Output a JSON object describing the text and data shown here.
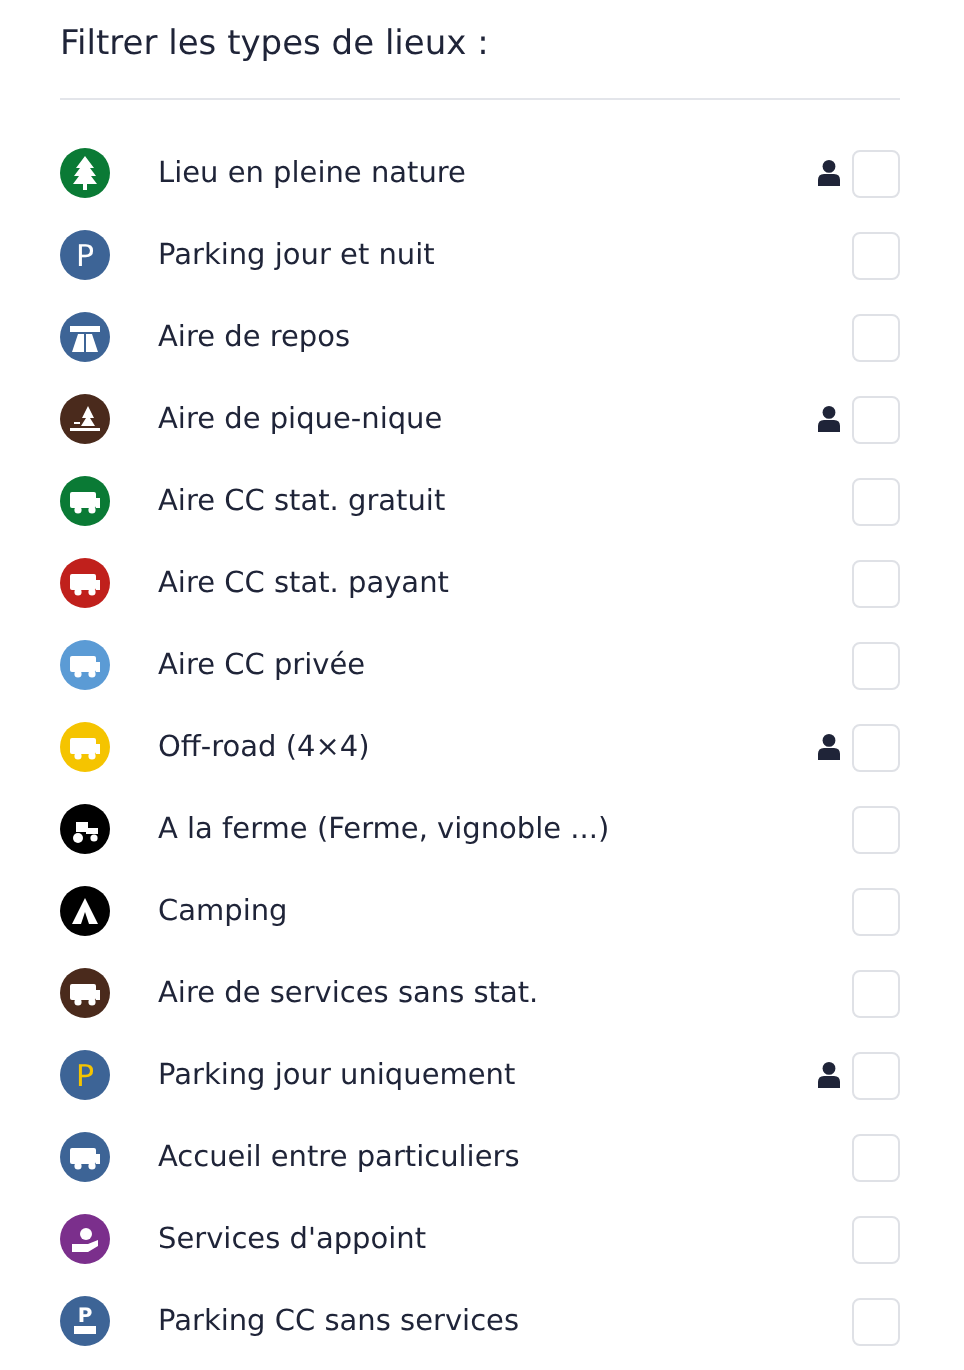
{
  "title": "Filtrer les types de lieux :",
  "items": [
    {
      "label": "Lieu en pleine nature",
      "kind": "tree",
      "color": "#0a7a35",
      "members_only": true,
      "checked": false
    },
    {
      "label": "Parking jour et nuit",
      "kind": "parking",
      "glyph": "P",
      "color": "#3d6496",
      "members_only": false,
      "checked": false
    },
    {
      "label": "Aire de repos",
      "kind": "highway",
      "color": "#3d6496",
      "members_only": false,
      "checked": false
    },
    {
      "label": "Aire de pique-nique",
      "kind": "picnic",
      "color": "#4a2a1c",
      "members_only": true,
      "checked": false
    },
    {
      "label": "Aire CC stat. gratuit",
      "kind": "camper",
      "color": "#0a7a35",
      "members_only": false,
      "checked": false
    },
    {
      "label": "Aire CC stat. payant",
      "kind": "camper",
      "color": "#c0201c",
      "members_only": false,
      "checked": false
    },
    {
      "label": "Aire CC privée",
      "kind": "camper",
      "color": "#5b9bd5",
      "members_only": false,
      "checked": false
    },
    {
      "label": "Off-road (4×4)",
      "kind": "camper",
      "color": "#f5c400",
      "members_only": true,
      "checked": false
    },
    {
      "label": "A la ferme (Ferme, vignoble ...)",
      "kind": "tractor",
      "color": "#000000",
      "members_only": false,
      "checked": false
    },
    {
      "label": "Camping",
      "kind": "tent",
      "color": "#000000",
      "members_only": false,
      "checked": false
    },
    {
      "label": "Aire de services sans stat.",
      "kind": "camper",
      "color": "#4a2a1c",
      "members_only": false,
      "checked": false
    },
    {
      "label": "Parking jour uniquement",
      "kind": "parking-day",
      "glyph": "P",
      "color": "#3d6496",
      "members_only": true,
      "checked": false
    },
    {
      "label": "Accueil entre particuliers",
      "kind": "camper",
      "color": "#3d6496",
      "members_only": false,
      "checked": false
    },
    {
      "label": "Services d'appoint",
      "kind": "hand",
      "color": "#7b2f8c",
      "members_only": false,
      "checked": false
    },
    {
      "label": "Parking CC sans services",
      "kind": "parking-camper",
      "glyph": "P",
      "color": "#3d6496",
      "members_only": false,
      "checked": false
    }
  ]
}
